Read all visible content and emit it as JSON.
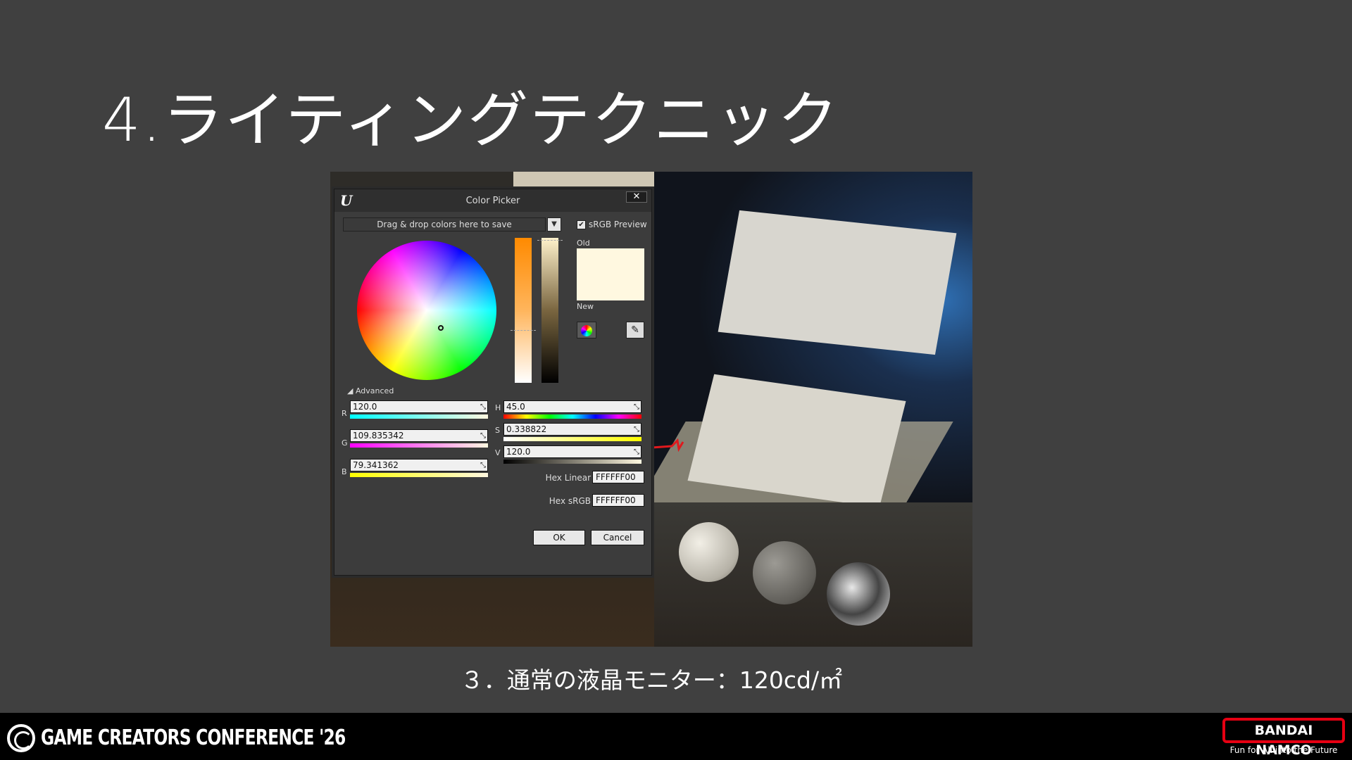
{
  "slide": {
    "title": "4.ライティングテクニック",
    "caption": "３．通常の液晶モニター：120cd/㎡"
  },
  "dialog": {
    "title": "Color Picker",
    "close_label": "✕",
    "drop_area_label": "Drag & drop colors here to save",
    "srgb_preview_label": "sRGB Preview",
    "srgb_preview_checked": true,
    "old_label": "Old",
    "new_label": "New",
    "advanced_label": "Advanced",
    "current_color": "#FFF8E0",
    "fields": {
      "r": {
        "label": "R",
        "value": "120.0"
      },
      "g": {
        "label": "G",
        "value": "109.835342"
      },
      "b": {
        "label": "B",
        "value": "79.341362"
      },
      "h": {
        "label": "H",
        "value": "45.0"
      },
      "s": {
        "label": "S",
        "value": "0.338822"
      },
      "v": {
        "label": "V",
        "value": "120.0"
      }
    },
    "hex_linear": {
      "label": "Hex Linear",
      "value": "FFFFFF00"
    },
    "hex_srgb": {
      "label": "Hex sRGB",
      "value": "FFFFFF00"
    },
    "ok_label": "OK",
    "cancel_label": "Cancel"
  },
  "footer": {
    "event_name": "GAME CREATORS CONFERENCE '26",
    "sponsor_name": "BANDAI NAMCO",
    "sponsor_tagline": "Fun for All into the Future"
  },
  "colors": {
    "background": "#404040",
    "footer": "#000000",
    "brand_red": "#E60012"
  }
}
